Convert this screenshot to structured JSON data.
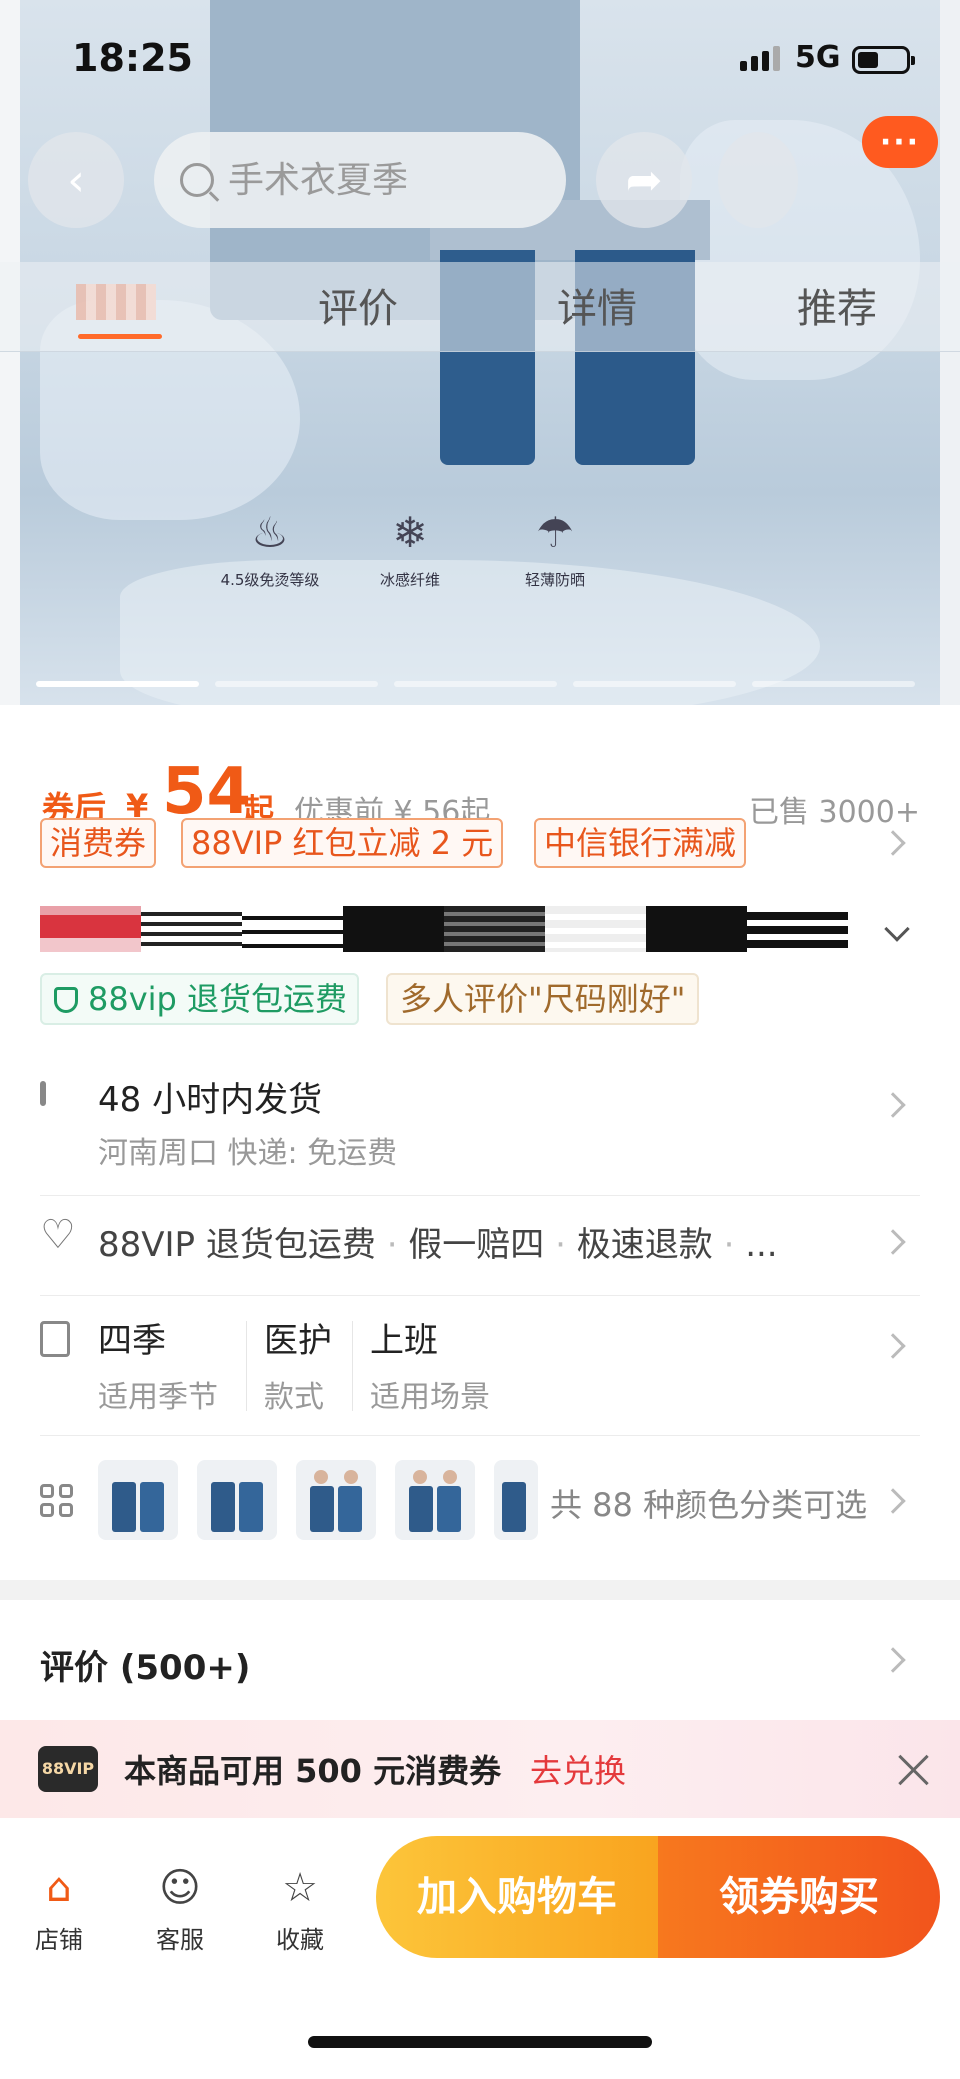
{
  "status_bar": {
    "time": "18:25",
    "network": "5G"
  },
  "search": {
    "placeholder": "手术衣夏季"
  },
  "tabs": [
    {
      "label": "评价"
    },
    {
      "label": "详情"
    },
    {
      "label": "推荐"
    }
  ],
  "hero": {
    "features": [
      "4.5级免烫等级",
      "冰感纤维",
      "轻薄防晒"
    ],
    "image_count": 5,
    "active_image": 1
  },
  "price": {
    "label": "券后",
    "currency": "¥",
    "value": "54",
    "suffix": "起",
    "before": "优惠前 ¥ 56起",
    "sold": "已售 3000+"
  },
  "coupons": [
    "消费券",
    "88VIP 红包立减 2 元",
    "中信银行满减"
  ],
  "tags": {
    "green": "88vip 退货包运费",
    "brown": "多人评价\"尺码刚好\""
  },
  "shipping": {
    "title": "48 小时内发货",
    "detail": "河南周口  快递:  免运费"
  },
  "services": {
    "items": [
      "88VIP 退货包运费",
      "假一赔四",
      "极速退款",
      "..."
    ]
  },
  "attributes": [
    {
      "value": "四季",
      "key": "适用季节"
    },
    {
      "value": "医护",
      "key": "款式"
    },
    {
      "value": "上班",
      "key": "适用场景"
    }
  ],
  "colors": {
    "text": "共 88 种颜色分类可选"
  },
  "reviews": {
    "title": "评价 (500+)"
  },
  "vip_banner": {
    "badge": "88VIP",
    "text": "本商品可用 500 元消费券",
    "link": "去兑换"
  },
  "bottom_bar": {
    "shop": "店铺",
    "service": "客服",
    "favorite": "收藏",
    "add_to_cart": "加入购物车",
    "buy": "领券购买"
  },
  "colors_theme": {
    "accent": "#f05a16",
    "green": "#1e9b63",
    "vip_red": "#e4393c"
  }
}
